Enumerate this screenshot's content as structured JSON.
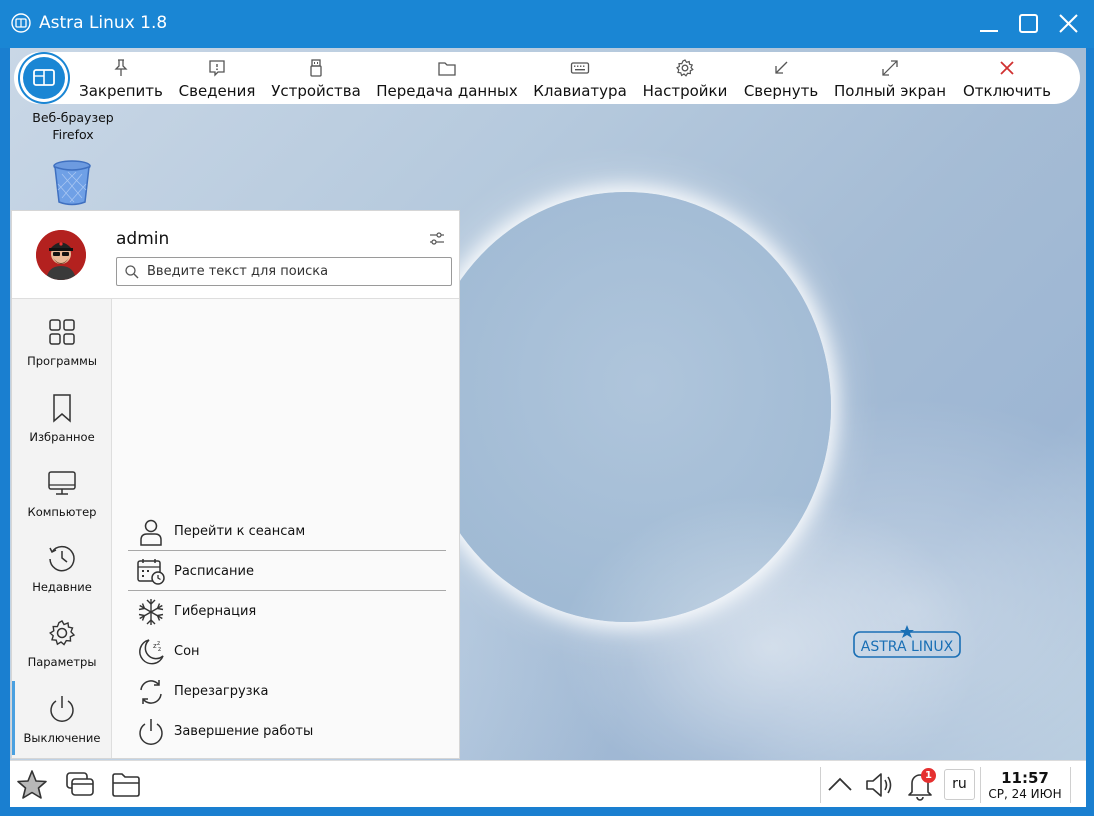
{
  "window": {
    "title": "Astra Linux 1.8"
  },
  "remote_toolbar": {
    "items": [
      {
        "label": "Закрепить",
        "icon": "pin-icon"
      },
      {
        "label": "Сведения",
        "icon": "info-icon"
      },
      {
        "label": "Устройства",
        "icon": "usb-icon"
      },
      {
        "label": "Передача данных",
        "icon": "folder-icon"
      },
      {
        "label": "Клавиатура",
        "icon": "keyboard-icon"
      },
      {
        "label": "Настройки",
        "icon": "gear-icon"
      },
      {
        "label": "Свернуть",
        "icon": "minimize-arrow-icon"
      },
      {
        "label": "Полный экран",
        "icon": "fullscreen-icon"
      },
      {
        "label": "Отключить",
        "icon": "close-icon"
      }
    ]
  },
  "desktop_icons": [
    {
      "label_line1": "Веб-браузер",
      "label_line2": "Firefox"
    },
    {
      "label": "Корзина"
    }
  ],
  "start_menu": {
    "username": "admin",
    "search": {
      "placeholder": "Введите текст для поиска",
      "value": ""
    },
    "sidebar": [
      {
        "label": "Программы",
        "icon": "grid-icon"
      },
      {
        "label": "Избранное",
        "icon": "bookmark-icon"
      },
      {
        "label": "Компьютер",
        "icon": "monitor-icon"
      },
      {
        "label": "Недавние",
        "icon": "history-icon"
      },
      {
        "label": "Параметры",
        "icon": "gear-icon"
      },
      {
        "label": "Выключение",
        "icon": "power-icon"
      }
    ],
    "power_actions": [
      {
        "label": "Перейти к сеансам",
        "icon": "user-icon"
      },
      {
        "label": "Расписание",
        "icon": "schedule-icon"
      },
      {
        "label": "Гибернация",
        "icon": "snowflake-icon"
      },
      {
        "label": "Сон",
        "icon": "moon-icon"
      },
      {
        "label": "Перезагрузка",
        "icon": "restart-icon"
      },
      {
        "label": "Завершение работы",
        "icon": "power-icon"
      }
    ]
  },
  "watermark": {
    "text": "ASTRA LINUX"
  },
  "taskbar": {
    "language": "ru",
    "notifications_count": "1",
    "time": "11:57",
    "date": "СР, 24 ИЮН"
  },
  "colors": {
    "accent": "#1a86d4",
    "title_bar": "#1a86d4",
    "badge": "#e53030"
  }
}
